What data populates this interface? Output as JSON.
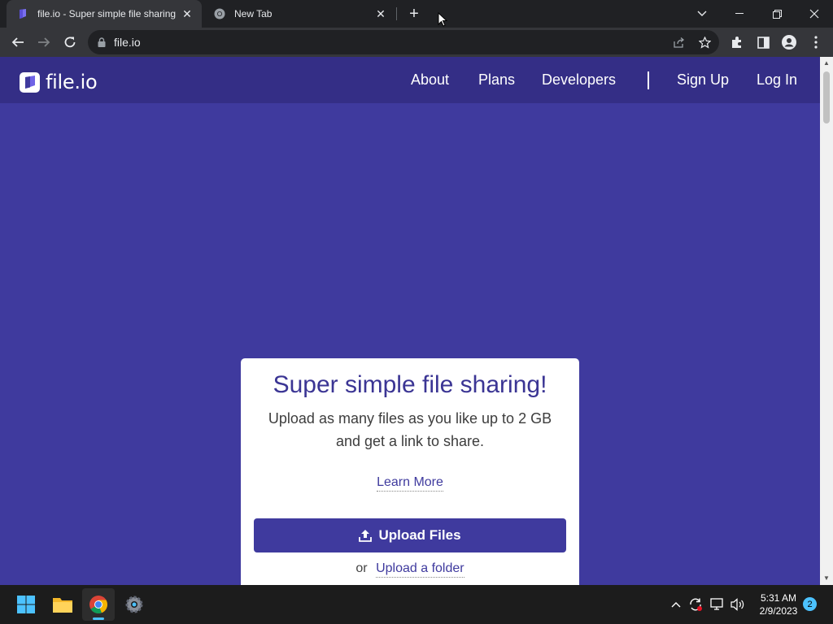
{
  "browser": {
    "tabs": [
      {
        "title": "file.io - Super simple file sharing",
        "active": true
      },
      {
        "title": "New Tab",
        "active": false
      }
    ],
    "address": "file.io"
  },
  "site": {
    "brand": "file.io",
    "nav": {
      "about": "About",
      "plans": "Plans",
      "developers": "Developers",
      "signup": "Sign Up",
      "login": "Log In"
    }
  },
  "card": {
    "heading": "Super simple file sharing!",
    "subtitle": "Upload as many files as you like up to 2 GB and get a link to share.",
    "learn_more": "Learn More",
    "upload_button": "Upload Files",
    "or_text": "or",
    "upload_folder": "Upload a folder"
  },
  "taskbar": {
    "time": "5:31 AM",
    "date": "2/9/2023",
    "notification_count": "2"
  },
  "colors": {
    "brand_primary": "#3f3a9e",
    "nav_bg": "#342e86",
    "heading_text": "#3b3594"
  },
  "icons": [
    "fileio-favicon",
    "chrome-favicon",
    "close-icon",
    "plus-icon",
    "chevron-down-icon",
    "minimize-icon",
    "restore-icon",
    "back-icon",
    "forward-icon",
    "reload-icon",
    "lock-icon",
    "share-icon",
    "star-icon",
    "extensions-icon",
    "sidepanel-icon",
    "profile-icon",
    "menu-icon",
    "upload-icon",
    "windows-start-icon",
    "file-explorer-icon",
    "chrome-icon",
    "settings-icon",
    "chevron-up-icon",
    "sync-icon",
    "network-icon",
    "volume-icon"
  ]
}
